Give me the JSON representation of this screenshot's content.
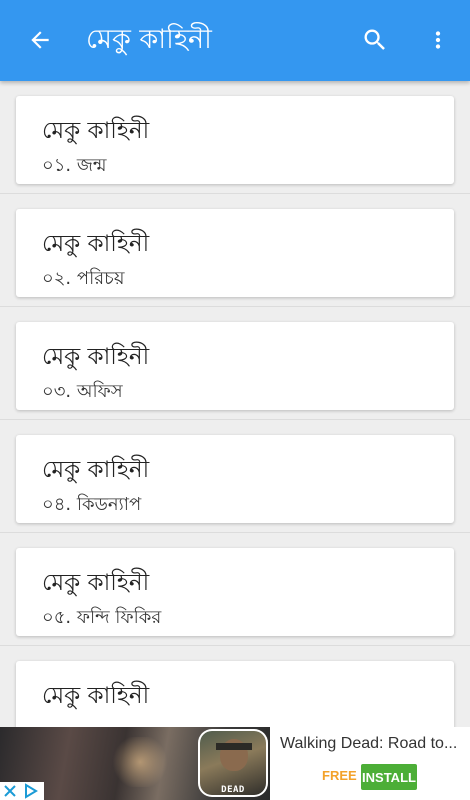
{
  "app_bar": {
    "title": "মেকু কাহিনী",
    "back_icon": "arrow-back-icon",
    "search_icon": "search-icon",
    "more_icon": "more-vert-icon",
    "color": "#3497f0"
  },
  "items": [
    {
      "title": "মেকু কাহিনী",
      "subtitle": "০১. জন্ম"
    },
    {
      "title": "মেকু কাহিনী",
      "subtitle": "০২. পরিচয়"
    },
    {
      "title": "মেকু কাহিনী",
      "subtitle": "০৩. অফিস"
    },
    {
      "title": "মেকু কাহিনী",
      "subtitle": "০৪. কিডন্যাপ"
    },
    {
      "title": "মেকু কাহিনী",
      "subtitle": "০৫. ফন্দি ফিকির"
    },
    {
      "title": "মেকু কাহিনী",
      "subtitle": ""
    }
  ],
  "ad": {
    "title": "Walking Dead: Road to...",
    "price": "FREE",
    "install_label": "INSTALL",
    "icon_brand": "DEAD",
    "adchoices_icon": "adchoices-icon",
    "close_icon": "ad-close-icon",
    "install_color": "#4cae37",
    "price_color": "#f3a22a"
  }
}
